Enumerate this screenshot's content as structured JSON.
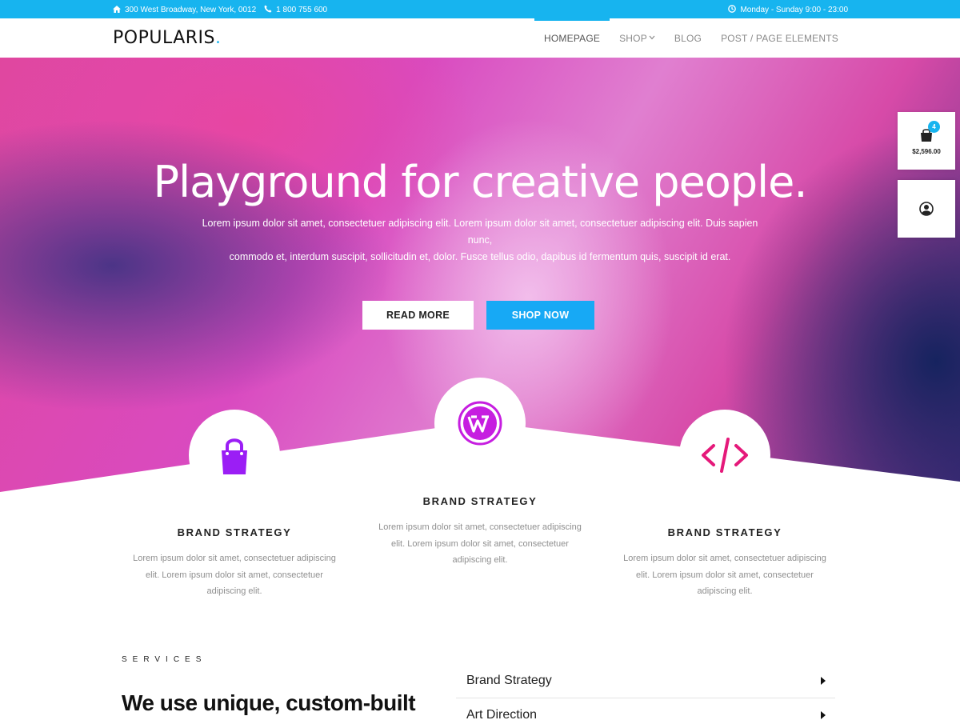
{
  "topbar": {
    "address": "300 West Broadway, New York, 0012",
    "phone": "1 800 755 600",
    "hours": "Monday - Sunday 9:00 - 23:00"
  },
  "header": {
    "logo_text": "POPULARIS",
    "logo_dot": ".",
    "nav": [
      {
        "label": "HOMEPAGE",
        "active": true
      },
      {
        "label": "SHOP",
        "has_dropdown": true
      },
      {
        "label": "BLOG"
      },
      {
        "label": "POST / PAGE ELEMENTS"
      }
    ]
  },
  "hero": {
    "title": "Playground for creative people.",
    "subtitle_line1": "Lorem ipsum dolor sit amet, consectetuer adipiscing elit. Lorem ipsum dolor sit amet, consectetuer adipiscing elit. Duis sapien nunc,",
    "subtitle_line2": "commodo et, interdum suscipit, sollicitudin et, dolor. Fusce tellus odio, dapibus id fermentum quis, suscipit id erat.",
    "read_more": "READ MORE",
    "shop_now": "SHOP NOW"
  },
  "widgets": {
    "cart_count": "4",
    "cart_total": "$2,596.00"
  },
  "features": [
    {
      "icon": "shopping-bag-icon",
      "title": "BRAND STRATEGY",
      "text_line1": "Lorem ipsum dolor sit amet, consectetuer adipiscing",
      "text_line2": "elit. Lorem ipsum dolor sit amet, consectetuer",
      "text_line3": "adipiscing elit."
    },
    {
      "icon": "wordpress-icon",
      "title": "BRAND STRATEGY",
      "text_line1": "Lorem ipsum dolor sit amet, consectetuer adipiscing",
      "text_line2": "elit. Lorem ipsum dolor sit amet, consectetuer",
      "text_line3": "adipiscing elit."
    },
    {
      "icon": "code-icon",
      "title": "BRAND STRATEGY",
      "text_line1": "Lorem ipsum dolor sit amet, consectetuer adipiscing",
      "text_line2": "elit. Lorem ipsum dolor sit amet, consectetuer",
      "text_line3": "adipiscing elit."
    }
  ],
  "services": {
    "label": "SERVICES",
    "heading": "We use unique, custom-built",
    "items": [
      {
        "label": "Brand Strategy"
      },
      {
        "label": "Art Direction"
      }
    ]
  },
  "colors": {
    "accent": "#17b4ef",
    "bag_purple": "#9b1ef5",
    "wordpress_magenta": "#c61ee0",
    "code_pink": "#e5197a",
    "hero_pink": "#e0479f",
    "hero_navy": "#16235f"
  }
}
